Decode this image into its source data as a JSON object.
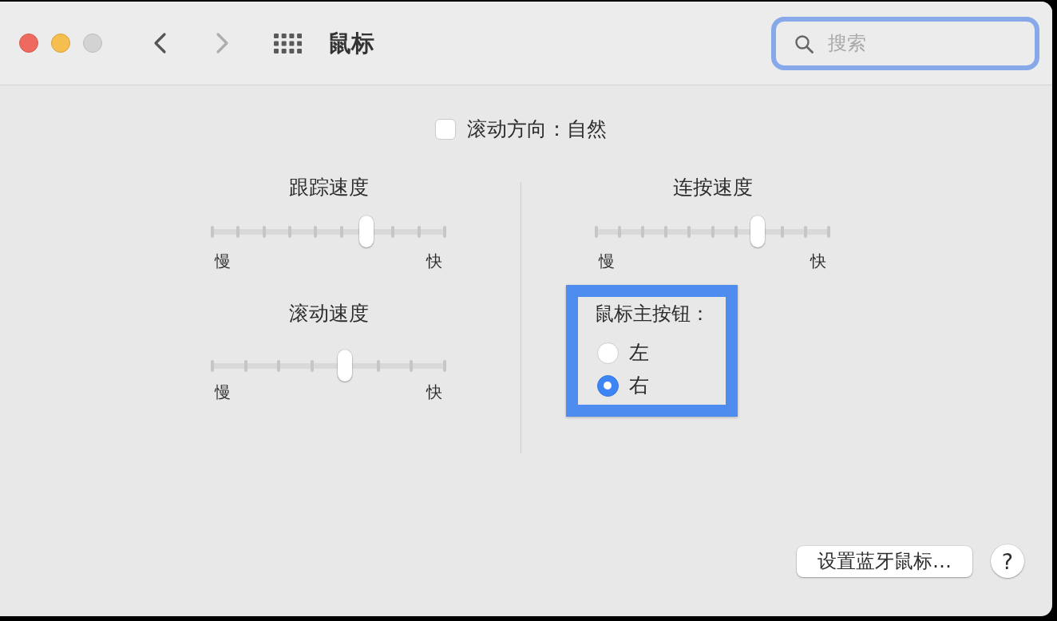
{
  "window": {
    "title": "鼠标",
    "controls": [
      {
        "kind": "close",
        "disabled": false
      },
      {
        "kind": "minimize",
        "disabled": false
      },
      {
        "kind": "zoom",
        "disabled": true
      }
    ]
  },
  "toolbar": {
    "navigation": [
      {
        "kind": "back",
        "disabled": false
      },
      {
        "kind": "forward",
        "disabled": true
      }
    ],
    "search": {
      "placeholder": "搜索",
      "focused": true
    }
  },
  "scroll_direction": {
    "label": "滚动方向：自然",
    "checked": false
  },
  "left_column": {
    "sliders": [
      {
        "title": "跟踪速度",
        "level": 0.66,
        "min_label": "慢",
        "max_label": "快"
      },
      {
        "title": "滚动速度",
        "level": 0.57,
        "min_label": "慢",
        "max_label": "快"
      }
    ]
  },
  "right_column": {
    "sliders": [
      {
        "title": "连按速度",
        "level": 0.69,
        "min_label": "慢",
        "max_label": "快"
      }
    ],
    "primary_button": {
      "label": "鼠标主按钮：",
      "focused": true,
      "options": [
        {
          "label": "左",
          "selected": false
        },
        {
          "label": "右",
          "selected": true
        }
      ]
    }
  },
  "buttons": [
    {
      "label": "设置蓝牙鼠标…"
    }
  ],
  "help_button": {
    "label": "?"
  }
}
